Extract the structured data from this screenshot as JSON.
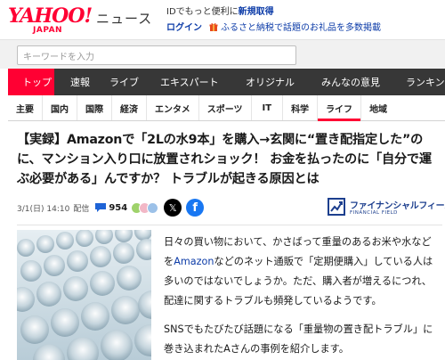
{
  "header": {
    "logo": "YAHOO!",
    "logo_sub": "JAPAN",
    "service_name": "ニュース",
    "promo_line1_prefix": "IDでもっと便利に",
    "promo_line1_strong": "新規取得",
    "login_label": "ログイン",
    "promo_line2_link": "ふるさと納税で話題のお礼品を多数掲載"
  },
  "search": {
    "placeholder": "キーワードを入力"
  },
  "main_nav": {
    "tabs": [
      {
        "label": "トップ",
        "active": true
      },
      {
        "label": "速報",
        "active": false
      },
      {
        "label": "ライブ",
        "active": false
      },
      {
        "label": "エキスパート",
        "active": false
      },
      {
        "label": "オリジナル",
        "active": false
      },
      {
        "label": "みんなの意見",
        "active": false
      },
      {
        "label": "ランキング",
        "active": false
      }
    ]
  },
  "sub_nav": {
    "items": [
      {
        "label": "主要",
        "active": false
      },
      {
        "label": "国内",
        "active": false
      },
      {
        "label": "国際",
        "active": false
      },
      {
        "label": "経済",
        "active": false
      },
      {
        "label": "エンタメ",
        "active": false
      },
      {
        "label": "スポーツ",
        "active": false
      },
      {
        "label": "IT",
        "active": false
      },
      {
        "label": "科学",
        "active": false
      },
      {
        "label": "ライフ",
        "active": true
      },
      {
        "label": "地域",
        "active": false
      }
    ]
  },
  "article": {
    "headline": "【実録】Amazonで「2Lの水9本」を購入→玄関に“置き配指定した”のに、マンション入り口に放置されショック！ お金を払ったのに「自分で運ぶ必要がある」んですか？ トラブルが起きる原因とは",
    "date": "3/1(日) 14:10",
    "date_label": "配信",
    "comment_count": "954",
    "source_name": "ファイナンシャルフィールド",
    "source_sub": "FINANCIAL FIELD",
    "paragraph1_a": "日々の買い物において、かさばって重量のあるお米や水などを",
    "paragraph1_link": "Amazon",
    "paragraph1_b": "などのネット通販で「定期便購入」している人は多いのではないでしょうか。ただ、購入者が増えるにつれ、配達に関するトラブルも頻発しているようです。",
    "paragraph2": "SNSでもたびたび話題になる「重量物の置き配トラブル」に巻き込まれたAさんの事例を紹介します。"
  },
  "colors": {
    "brand_red": "#ff0033",
    "nav_dark": "#373737",
    "link_blue": "#0d3ca8",
    "facebook_blue": "#1877f2"
  }
}
